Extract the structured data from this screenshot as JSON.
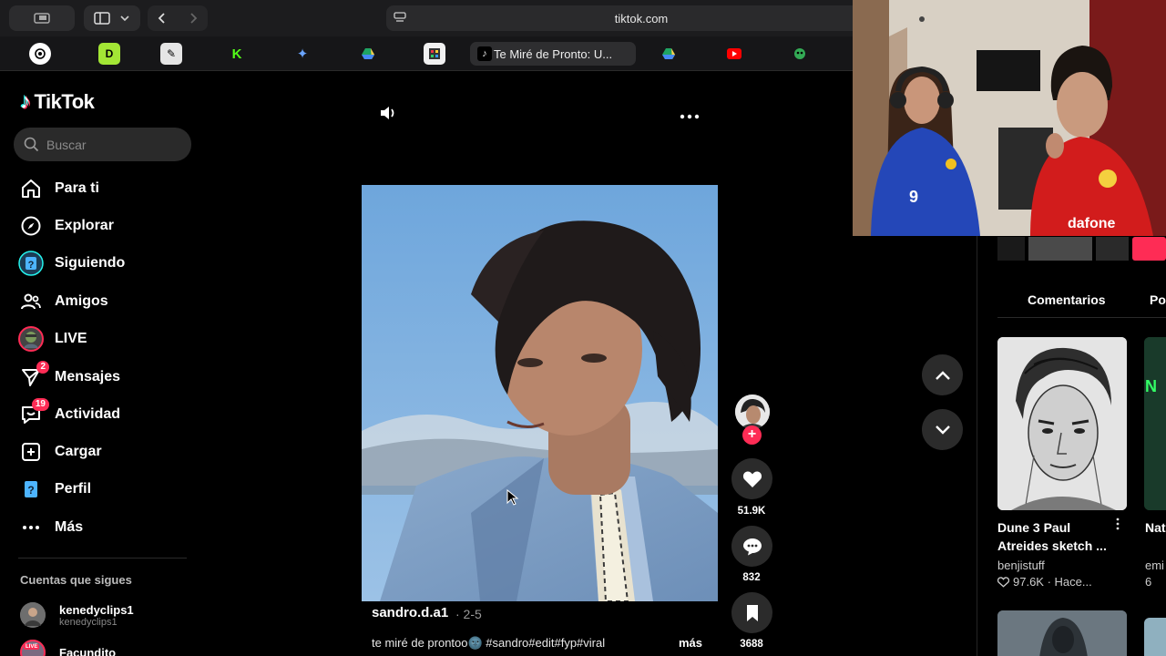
{
  "browser": {
    "url": "tiktok.com",
    "active_tab_title": "Te Miré de Pronto: U..."
  },
  "app": {
    "name": "TikTok"
  },
  "search": {
    "placeholder": "Buscar"
  },
  "nav": {
    "items": [
      {
        "label": "Para ti",
        "icon": "home-icon"
      },
      {
        "label": "Explorar",
        "icon": "compass-icon"
      },
      {
        "label": "Siguiendo",
        "icon": "following-avatar-icon"
      },
      {
        "label": "Amigos",
        "icon": "friends-icon"
      },
      {
        "label": "LIVE",
        "icon": "live-avatar-icon"
      },
      {
        "label": "Mensajes",
        "icon": "send-icon",
        "badge": "2"
      },
      {
        "label": "Actividad",
        "icon": "inbox-icon",
        "badge": "19"
      },
      {
        "label": "Cargar",
        "icon": "upload-icon"
      },
      {
        "label": "Perfil",
        "icon": "profile-icon"
      },
      {
        "label": "Más",
        "icon": "more-icon"
      }
    ]
  },
  "following": {
    "title": "Cuentas que sigues",
    "accounts": [
      {
        "name": "kenedyclips1",
        "handle": "kenedyclips1"
      },
      {
        "name": "Facundito",
        "badge": "LIVE"
      }
    ]
  },
  "video": {
    "username": "sandro.d.a1",
    "date": "· 2-5",
    "description": "te miré de prontoo🌚 #sandro#edit#fyp#viral",
    "more_label": "más",
    "likes": "51.9K",
    "comments": "832",
    "saves": "3688"
  },
  "panel": {
    "tabs": [
      "Comentarios",
      "Po"
    ],
    "cards": [
      {
        "title": "Dune 3 Paul Atreides sketch ...",
        "author": "benjistuff",
        "stats": "97.6K · Hace..."
      },
      {
        "title": "Nat @g",
        "author": "emi",
        "stats": "6"
      }
    ]
  },
  "colors": {
    "accent": "#fe2c55",
    "accent_cyan": "#25f4ee",
    "sidebar_bg": "#000000",
    "button_bg": "#2b2b2b"
  }
}
